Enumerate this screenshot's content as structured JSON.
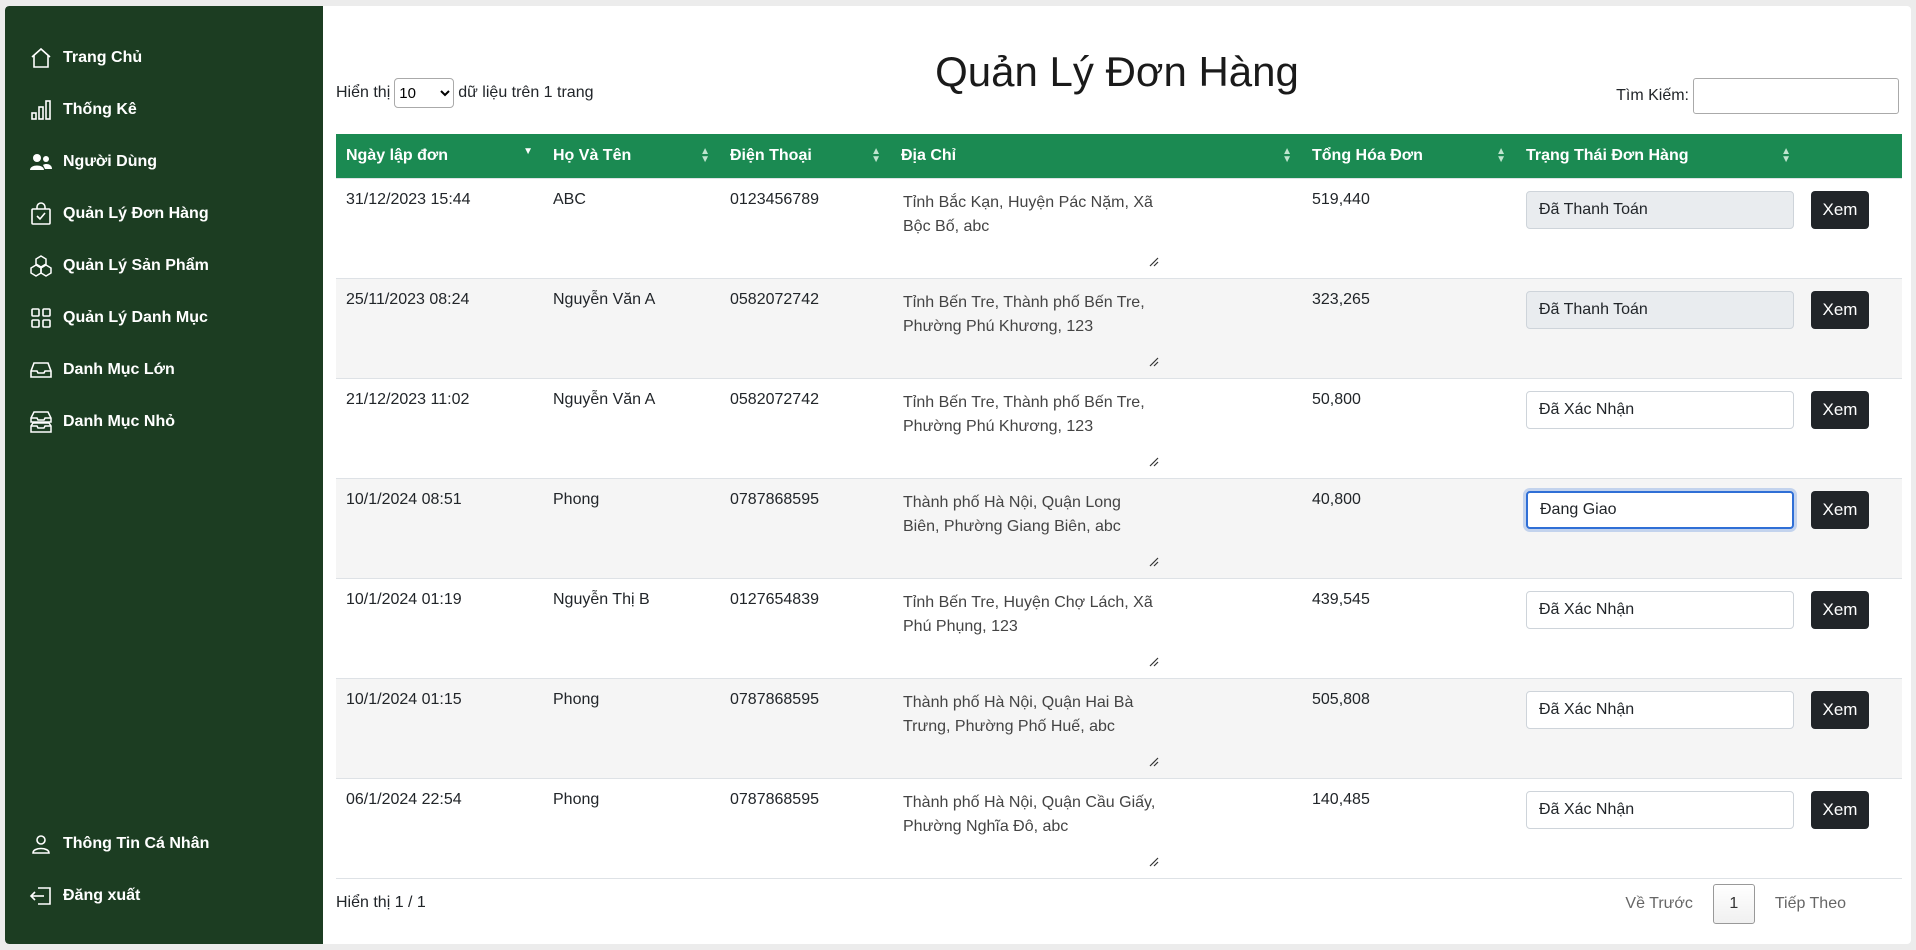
{
  "sidebar": {
    "items": [
      {
        "label": "Trang Chủ",
        "icon": "home-icon"
      },
      {
        "label": "Thống Kê",
        "icon": "bar-chart-icon"
      },
      {
        "label": "Người Dùng",
        "icon": "users-icon"
      },
      {
        "label": "Quản Lý Đơn Hàng",
        "icon": "shopping-bag-check-icon"
      },
      {
        "label": "Quản Lý Sản Phẩm",
        "icon": "boxes-icon"
      },
      {
        "label": "Quản Lý Danh Mục",
        "icon": "grid-icon"
      },
      {
        "label": "Danh Mục Lớn",
        "icon": "inbox-icon"
      },
      {
        "label": "Danh Mục Nhỏ",
        "icon": "inboxes-icon"
      }
    ],
    "bottom": [
      {
        "label": "Thông Tin Cá Nhân",
        "icon": "person-icon"
      },
      {
        "label": "Đăng xuất",
        "icon": "logout-icon"
      }
    ]
  },
  "page": {
    "title": "Quản Lý Đơn Hàng",
    "length_prefix": "Hiển thị",
    "length_value": "10",
    "length_suffix": "dữ liệu trên 1 trang",
    "search_label": "Tìm Kiếm:",
    "search_value": ""
  },
  "table": {
    "columns": [
      "Ngày lập đơn",
      "Họ Và Tên",
      "Điện Thoại",
      "Địa Chỉ",
      "Tổng Hóa Đơn",
      "Trạng Thái Đơn Hàng",
      ""
    ],
    "view_label": "Xem",
    "rows": [
      {
        "date": "31/12/2023 15:44",
        "name": "ABC",
        "phone": "0123456789",
        "address": "Tỉnh Bắc Kạn, Huyện Pác Nặm, Xã Bộc Bố, abc",
        "total": "519,440",
        "status": "Đã Thanh Toán"
      },
      {
        "date": "25/11/2023 08:24",
        "name": "Nguyễn Văn A",
        "phone": "0582072742",
        "address": "Tỉnh Bến Tre, Thành phố Bến Tre, Phường Phú Khương, 123",
        "total": "323,265",
        "status": "Đã Thanh Toán"
      },
      {
        "date": "21/12/2023 11:02",
        "name": "Nguyễn Văn A",
        "phone": "0582072742",
        "address": "Tỉnh Bến Tre, Thành phố Bến Tre, Phường Phú Khương, 123",
        "total": "50,800",
        "status": "Đã Xác Nhận"
      },
      {
        "date": "10/1/2024 08:51",
        "name": "Phong",
        "phone": "0787868595",
        "address": "Thành phố Hà Nội, Quận Long Biên, Phường Giang Biên, abc",
        "total": "40,800",
        "status": "Đang Giao"
      },
      {
        "date": "10/1/2024 01:19",
        "name": "Nguyễn Thị B",
        "phone": "0127654839",
        "address": "Tỉnh Bến Tre, Huyện Chợ Lách, Xã Phú Phụng, 123",
        "total": "439,545",
        "status": "Đã Xác Nhận"
      },
      {
        "date": "10/1/2024 01:15",
        "name": "Phong",
        "phone": "0787868595",
        "address": "Thành phố Hà Nội, Quận Hai Bà Trưng, Phường Phố Huế, abc",
        "total": "505,808",
        "status": "Đã Xác Nhận"
      },
      {
        "date": "06/1/2024 22:54",
        "name": "Phong",
        "phone": "0787868595",
        "address": "Thành phố Hà Nội, Quận Cầu Giấy, Phường Nghĩa Đô, abc",
        "total": "140,485",
        "status": "Đã Xác Nhận"
      }
    ]
  },
  "footer": {
    "info": "Hiển thị 1 / 1",
    "prev": "Về Trước",
    "current": "1",
    "next": "Tiếp Theo"
  },
  "colors": {
    "sidebar": "#1c3d22",
    "table_header": "#1b8a52",
    "button": "#212529"
  }
}
